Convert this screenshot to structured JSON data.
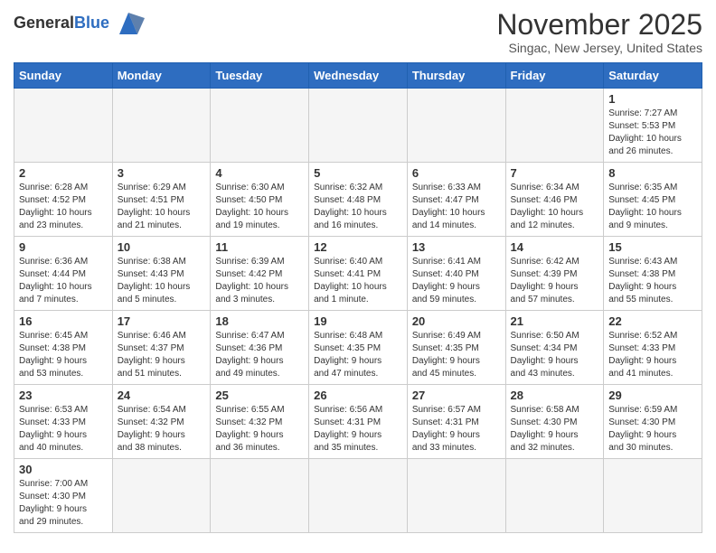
{
  "header": {
    "logo_general": "General",
    "logo_blue": "Blue",
    "month_title": "November 2025",
    "subtitle": "Singac, New Jersey, United States"
  },
  "days_of_week": [
    "Sunday",
    "Monday",
    "Tuesday",
    "Wednesday",
    "Thursday",
    "Friday",
    "Saturday"
  ],
  "weeks": [
    [
      {
        "day": "",
        "info": ""
      },
      {
        "day": "",
        "info": ""
      },
      {
        "day": "",
        "info": ""
      },
      {
        "day": "",
        "info": ""
      },
      {
        "day": "",
        "info": ""
      },
      {
        "day": "",
        "info": ""
      },
      {
        "day": "1",
        "info": "Sunrise: 7:27 AM\nSunset: 5:53 PM\nDaylight: 10 hours\nand 26 minutes."
      }
    ],
    [
      {
        "day": "2",
        "info": "Sunrise: 6:28 AM\nSunset: 4:52 PM\nDaylight: 10 hours\nand 23 minutes."
      },
      {
        "day": "3",
        "info": "Sunrise: 6:29 AM\nSunset: 4:51 PM\nDaylight: 10 hours\nand 21 minutes."
      },
      {
        "day": "4",
        "info": "Sunrise: 6:30 AM\nSunset: 4:50 PM\nDaylight: 10 hours\nand 19 minutes."
      },
      {
        "day": "5",
        "info": "Sunrise: 6:32 AM\nSunset: 4:48 PM\nDaylight: 10 hours\nand 16 minutes."
      },
      {
        "day": "6",
        "info": "Sunrise: 6:33 AM\nSunset: 4:47 PM\nDaylight: 10 hours\nand 14 minutes."
      },
      {
        "day": "7",
        "info": "Sunrise: 6:34 AM\nSunset: 4:46 PM\nDaylight: 10 hours\nand 12 minutes."
      },
      {
        "day": "8",
        "info": "Sunrise: 6:35 AM\nSunset: 4:45 PM\nDaylight: 10 hours\nand 9 minutes."
      }
    ],
    [
      {
        "day": "9",
        "info": "Sunrise: 6:36 AM\nSunset: 4:44 PM\nDaylight: 10 hours\nand 7 minutes."
      },
      {
        "day": "10",
        "info": "Sunrise: 6:38 AM\nSunset: 4:43 PM\nDaylight: 10 hours\nand 5 minutes."
      },
      {
        "day": "11",
        "info": "Sunrise: 6:39 AM\nSunset: 4:42 PM\nDaylight: 10 hours\nand 3 minutes."
      },
      {
        "day": "12",
        "info": "Sunrise: 6:40 AM\nSunset: 4:41 PM\nDaylight: 10 hours\nand 1 minute."
      },
      {
        "day": "13",
        "info": "Sunrise: 6:41 AM\nSunset: 4:40 PM\nDaylight: 9 hours\nand 59 minutes."
      },
      {
        "day": "14",
        "info": "Sunrise: 6:42 AM\nSunset: 4:39 PM\nDaylight: 9 hours\nand 57 minutes."
      },
      {
        "day": "15",
        "info": "Sunrise: 6:43 AM\nSunset: 4:38 PM\nDaylight: 9 hours\nand 55 minutes."
      }
    ],
    [
      {
        "day": "16",
        "info": "Sunrise: 6:45 AM\nSunset: 4:38 PM\nDaylight: 9 hours\nand 53 minutes."
      },
      {
        "day": "17",
        "info": "Sunrise: 6:46 AM\nSunset: 4:37 PM\nDaylight: 9 hours\nand 51 minutes."
      },
      {
        "day": "18",
        "info": "Sunrise: 6:47 AM\nSunset: 4:36 PM\nDaylight: 9 hours\nand 49 minutes."
      },
      {
        "day": "19",
        "info": "Sunrise: 6:48 AM\nSunset: 4:35 PM\nDaylight: 9 hours\nand 47 minutes."
      },
      {
        "day": "20",
        "info": "Sunrise: 6:49 AM\nSunset: 4:35 PM\nDaylight: 9 hours\nand 45 minutes."
      },
      {
        "day": "21",
        "info": "Sunrise: 6:50 AM\nSunset: 4:34 PM\nDaylight: 9 hours\nand 43 minutes."
      },
      {
        "day": "22",
        "info": "Sunrise: 6:52 AM\nSunset: 4:33 PM\nDaylight: 9 hours\nand 41 minutes."
      }
    ],
    [
      {
        "day": "23",
        "info": "Sunrise: 6:53 AM\nSunset: 4:33 PM\nDaylight: 9 hours\nand 40 minutes."
      },
      {
        "day": "24",
        "info": "Sunrise: 6:54 AM\nSunset: 4:32 PM\nDaylight: 9 hours\nand 38 minutes."
      },
      {
        "day": "25",
        "info": "Sunrise: 6:55 AM\nSunset: 4:32 PM\nDaylight: 9 hours\nand 36 minutes."
      },
      {
        "day": "26",
        "info": "Sunrise: 6:56 AM\nSunset: 4:31 PM\nDaylight: 9 hours\nand 35 minutes."
      },
      {
        "day": "27",
        "info": "Sunrise: 6:57 AM\nSunset: 4:31 PM\nDaylight: 9 hours\nand 33 minutes."
      },
      {
        "day": "28",
        "info": "Sunrise: 6:58 AM\nSunset: 4:30 PM\nDaylight: 9 hours\nand 32 minutes."
      },
      {
        "day": "29",
        "info": "Sunrise: 6:59 AM\nSunset: 4:30 PM\nDaylight: 9 hours\nand 30 minutes."
      }
    ],
    [
      {
        "day": "30",
        "info": "Sunrise: 7:00 AM\nSunset: 4:30 PM\nDaylight: 9 hours\nand 29 minutes."
      },
      {
        "day": "",
        "info": ""
      },
      {
        "day": "",
        "info": ""
      },
      {
        "day": "",
        "info": ""
      },
      {
        "day": "",
        "info": ""
      },
      {
        "day": "",
        "info": ""
      },
      {
        "day": "",
        "info": ""
      }
    ]
  ]
}
